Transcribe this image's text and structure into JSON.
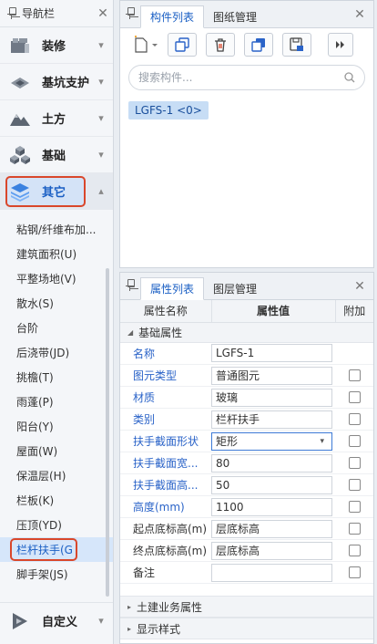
{
  "nav": {
    "title": "导航栏",
    "categories": [
      {
        "label": "装修",
        "icon": "decoration-icon"
      },
      {
        "label": "基坑支护",
        "icon": "foundation-pit-icon"
      },
      {
        "label": "土方",
        "icon": "earthwork-icon"
      },
      {
        "label": "基础",
        "icon": "foundation-icon"
      },
      {
        "label": "其它",
        "icon": "layers-icon"
      }
    ],
    "sub_items": [
      "粘钢/纤维布加...",
      "建筑面积(U)",
      "平整场地(V)",
      "散水(S)",
      "台阶",
      "后浇带(JD)",
      "挑檐(T)",
      "雨蓬(P)",
      "阳台(Y)",
      "屋面(W)",
      "保温层(H)",
      "栏板(K)",
      "压顶(YD)",
      "栏杆扶手(G",
      "脚手架(JS)"
    ],
    "active_sub": "栏杆扶手(G",
    "bottom_category": "自定义"
  },
  "component_panel": {
    "tabs": [
      "构件列表",
      "图纸管理"
    ],
    "search_placeholder": "搜索构件...",
    "items": [
      "LGFS-1 <0>"
    ]
  },
  "property_panel": {
    "tabs": [
      "属性列表",
      "图层管理"
    ],
    "headers": {
      "name": "属性名称",
      "value": "属性值",
      "extra": "附加"
    },
    "group_basic": "基础属性",
    "rows": [
      {
        "name": "名称",
        "value": "LGFS-1",
        "blue": true,
        "checkbox": false
      },
      {
        "name": "图元类型",
        "value": "普通图元",
        "blue": true,
        "checkbox": true
      },
      {
        "name": "材质",
        "value": "玻璃",
        "blue": true,
        "checkbox": true
      },
      {
        "name": "类别",
        "value": "栏杆扶手",
        "blue": true,
        "checkbox": true
      },
      {
        "name": "扶手截面形状",
        "value": "矩形",
        "blue": true,
        "checkbox": true,
        "dropdown": true
      },
      {
        "name": "扶手截面宽...",
        "value": "80",
        "blue": true,
        "checkbox": true
      },
      {
        "name": "扶手截面高...",
        "value": "50",
        "blue": true,
        "checkbox": true
      },
      {
        "name": "高度(mm)",
        "value": "1100",
        "blue": true,
        "checkbox": true
      },
      {
        "name": "起点底标高(m)",
        "value": "层底标高",
        "blue": false,
        "checkbox": true
      },
      {
        "name": "终点底标高(m)",
        "value": "层底标高",
        "blue": false,
        "checkbox": true
      },
      {
        "name": "备注",
        "value": "",
        "blue": false,
        "checkbox": true
      }
    ],
    "group_civil": "土建业务属性",
    "group_display": "显示样式"
  },
  "colors": {
    "accent": "#1a5fc4",
    "highlight": "#d9472b",
    "chip": "#c7ddf5"
  }
}
